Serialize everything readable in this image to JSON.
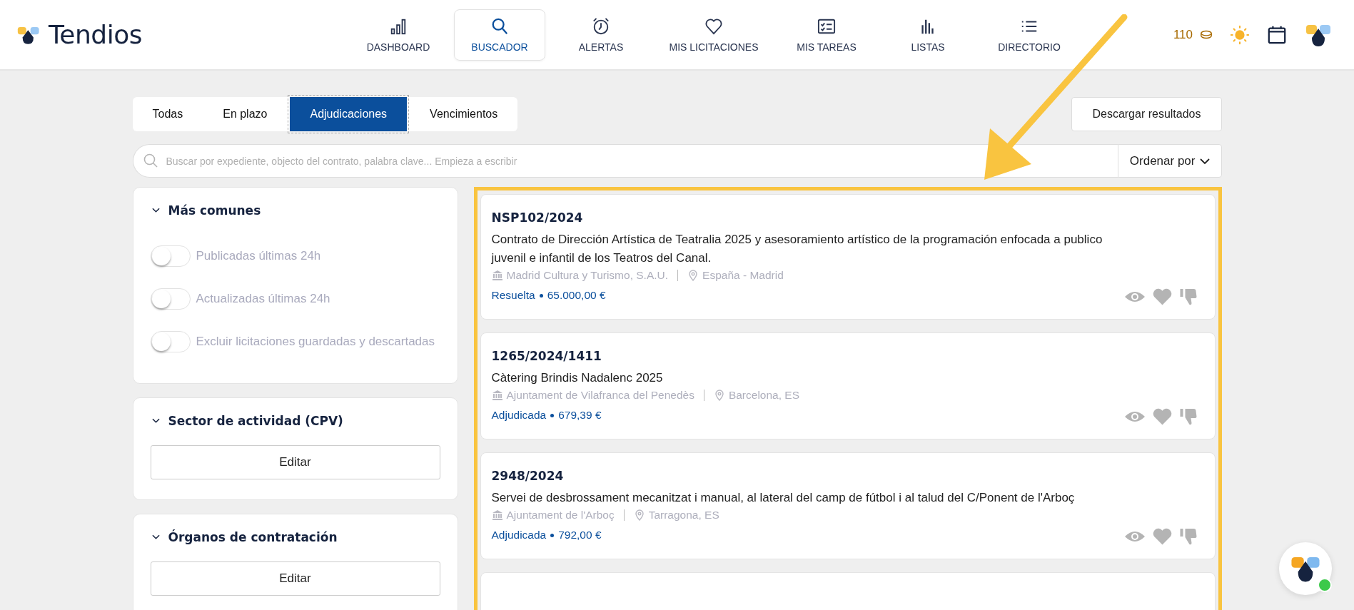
{
  "brand": {
    "name": "Tendios"
  },
  "nav": [
    {
      "label": "DASHBOARD",
      "kind": "bars",
      "selected": false
    },
    {
      "label": "BUSCADOR",
      "kind": "search",
      "selected": true
    },
    {
      "label": "ALERTAS",
      "kind": "alarm",
      "selected": false
    },
    {
      "label": "MIS LICITACIONES",
      "kind": "heart",
      "selected": false
    },
    {
      "label": "MIS TAREAS",
      "kind": "tasks",
      "selected": false
    },
    {
      "label": "LISTAS",
      "kind": "chart",
      "selected": false
    },
    {
      "label": "DIRECTORIO",
      "kind": "list",
      "selected": false
    }
  ],
  "credits": "110",
  "tabs": [
    {
      "label": "Todas",
      "selected": false
    },
    {
      "label": "En plazo",
      "selected": false
    },
    {
      "label": "Adjudicaciones",
      "selected": true
    },
    {
      "label": "Vencimientos",
      "selected": false
    }
  ],
  "download_button": "Descargar resultados",
  "search": {
    "placeholder": "Buscar por expediente, objecto del contrato, palabra clave... Empieza a escribir"
  },
  "sort_button": "Ordenar por",
  "filters": [
    {
      "title": "Más comunes",
      "kind": "toggles",
      "toggles": [
        {
          "label": "Publicadas últimas 24h",
          "on": false
        },
        {
          "label": "Actualizadas últimas 24h",
          "on": false
        },
        {
          "label": "Excluir licitaciones guardadas y descartadas",
          "on": false
        }
      ]
    },
    {
      "title": "Sector de actividad (CPV)",
      "kind": "button",
      "button": "Editar"
    },
    {
      "title": "Órganos de contratación",
      "kind": "button",
      "button": "Editar"
    }
  ],
  "results": [
    {
      "id": "NSP102/2024",
      "description": "Contrato de Dirección Artística de Teatralia 2025 y asesoramiento artístico de la programación enfocada a publico juvenil e infantil de los Teatros del Canal.",
      "organization": "Madrid Cultura y Turismo, S.A.U.",
      "location": "España - Madrid",
      "status": "Resuelta",
      "amount": "65.000,00 €"
    },
    {
      "id": "1265/2024/1411",
      "description": "Càtering Brindis Nadalenc 2025",
      "organization": "Ajuntament de Vilafranca del Penedès",
      "location": "Barcelona, ES",
      "status": "Adjudicada",
      "amount": "679,39 €"
    },
    {
      "id": "2948/2024",
      "description": "Servei de desbrossament mecanitzat i manual, al lateral del camp de fútbol i al talud del C/Ponent de l'Arboç",
      "organization": "Ajuntament de l'Arboç",
      "location": "Tarragona, ES",
      "status": "Adjudicada",
      "amount": "792,00 €"
    }
  ]
}
